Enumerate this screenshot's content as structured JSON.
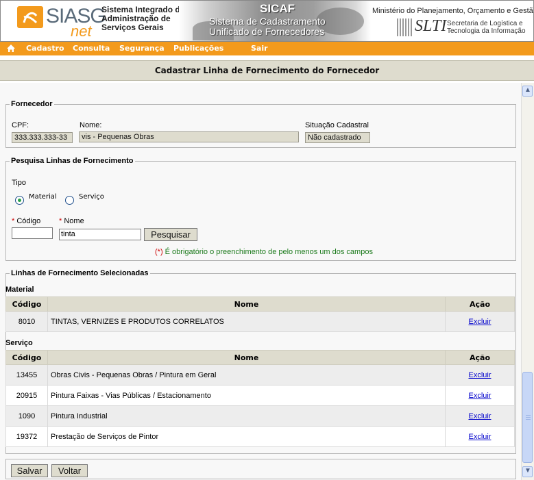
{
  "header": {
    "logo_text": "SIASG",
    "logo_net": "net",
    "siasg_description": [
      "Sistema Integrado de",
      "Administração de",
      "Serviços Gerais"
    ],
    "sicaf_title": "SICAF",
    "sicaf_subtitle_1": "Sistema de Cadastramento",
    "sicaf_subtitle_2": "Unificado de Fornecedores",
    "ministry": "Ministério do Planejamento, Orçamento e Gestão",
    "slti_logo": "SLTI",
    "slti_description": [
      "Secretaria de Logística e",
      "Tecnologia da Informação"
    ]
  },
  "menu": {
    "home_icon": "home-icon",
    "items": [
      "Cadastro",
      "Consulta",
      "Segurança",
      "Publicações",
      "Sair"
    ]
  },
  "page": {
    "title": "Cadastrar Linha de Fornecimento do Fornecedor"
  },
  "fornecedor": {
    "legend": "Fornecedor",
    "cpf_label": "CPF:",
    "cpf_value": "333.333.333-33",
    "nome_label": "Nome:",
    "nome_value": "vis - Pequenas Obras",
    "situacao_label": "Situação Cadastral",
    "situacao_value": "Não cadastrado"
  },
  "pesquisa": {
    "legend": "Pesquisa Linhas de Fornecimento",
    "tipo_label": "Tipo",
    "radio_material": "Material",
    "radio_servico": "Serviço",
    "selected": "Material",
    "codigo_label": "Código",
    "nome_label": "Nome",
    "required_mark": "*",
    "codigo_value": "",
    "nome_value": "tinta",
    "search_button": "Pesquisar",
    "hint_mark": "(*)",
    "hint_text": " É obrigatório o preenchimento de pelo menos um dos campos"
  },
  "selecionadas": {
    "legend": "Linhas de Fornecimento Selecionadas",
    "columns": {
      "codigo": "Código",
      "nome": "Nome",
      "acao": "Ação"
    },
    "material_title": "Material",
    "material_rows": [
      {
        "codigo": "8010",
        "nome": "TINTAS, VERNIZES E PRODUTOS CORRELATOS",
        "acao": "Excluir"
      }
    ],
    "servico_title": "Serviço",
    "servico_rows": [
      {
        "codigo": "13455",
        "nome": "Obras Civis - Pequenas Obras / Pintura em Geral",
        "acao": "Excluir"
      },
      {
        "codigo": "20915",
        "nome": "Pintura Faixas - Vias Públicas / Estacionamento",
        "acao": "Excluir"
      },
      {
        "codigo": "1090",
        "nome": "Pintura Industrial",
        "acao": "Excluir"
      },
      {
        "codigo": "19372",
        "nome": "Prestação de Serviços de Pintor",
        "acao": "Excluir"
      }
    ]
  },
  "footer": {
    "save_button": "Salvar",
    "back_button": "Voltar"
  },
  "colors": {
    "menu_orange": "#f39a1c",
    "panel_beige": "#dedcce",
    "link_blue": "#0000cc",
    "hint_green": "#1c7a1c"
  }
}
